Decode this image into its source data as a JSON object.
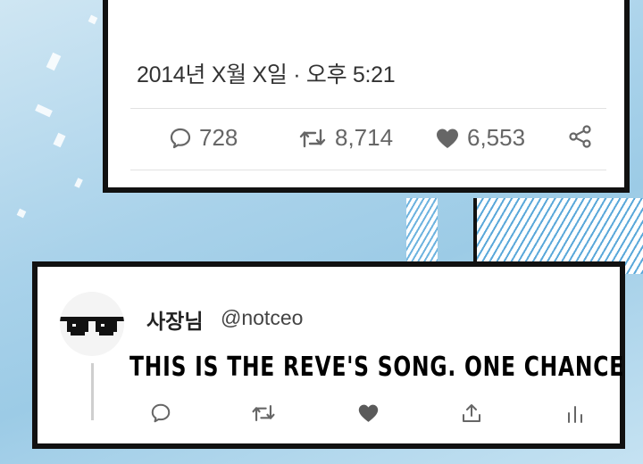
{
  "tweet": {
    "timestamp": "2014년 X월 X일 · 오후 5:21",
    "stats": {
      "replies": "728",
      "retweets": "8,714",
      "likes": "6,553"
    },
    "icons": [
      "reply-icon",
      "retweet-icon",
      "like-icon",
      "share-icon"
    ]
  },
  "reply": {
    "display_name": "사장님",
    "handle": "@notceo",
    "text": "THIS IS THE REVE'S SONG. ONE CHANCE",
    "icons": [
      "reply-icon",
      "retweet-icon",
      "like-icon",
      "share-icon",
      "analytics-icon"
    ]
  },
  "colors": {
    "icon_gray": "#666666",
    "panel_border": "#111111",
    "background": "#a9d2ea"
  }
}
